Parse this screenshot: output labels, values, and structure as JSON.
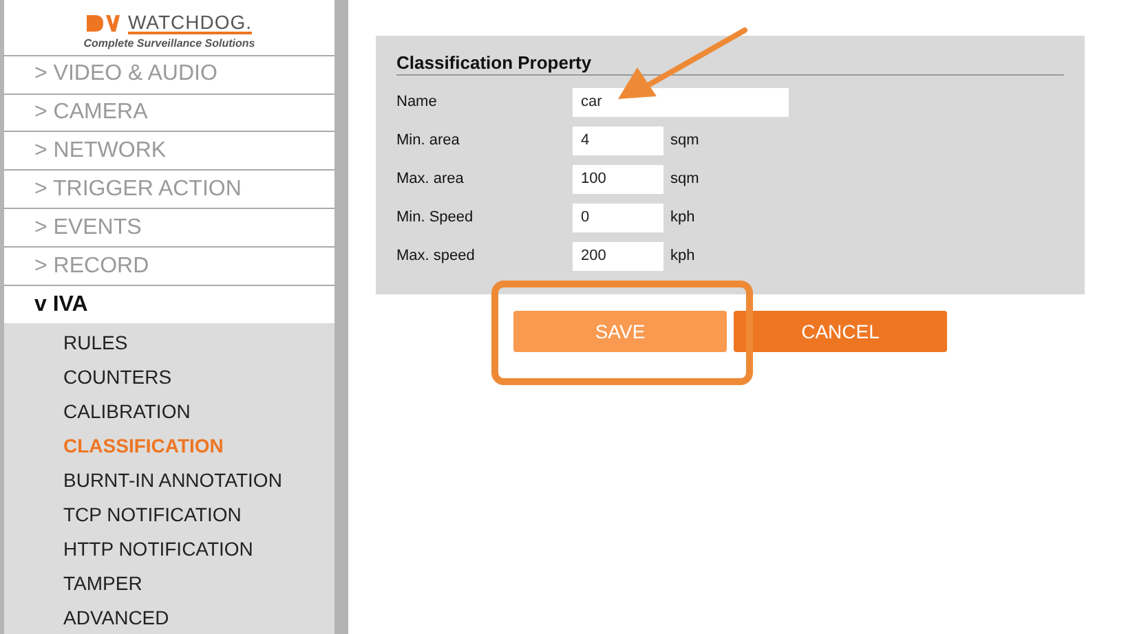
{
  "logo": {
    "wordmark": "WATCHDOG.",
    "tagline": "Complete Surveillance Solutions"
  },
  "sidebar": {
    "items": [
      {
        "label": "> VIDEO & AUDIO",
        "expanded": false
      },
      {
        "label": "> CAMERA",
        "expanded": false
      },
      {
        "label": "> NETWORK",
        "expanded": false
      },
      {
        "label": "> TRIGGER ACTION",
        "expanded": false
      },
      {
        "label": "> EVENTS",
        "expanded": false
      },
      {
        "label": "> RECORD",
        "expanded": false
      },
      {
        "label": "v IVA",
        "expanded": true,
        "children": [
          {
            "label": "RULES",
            "selected": false
          },
          {
            "label": "COUNTERS",
            "selected": false
          },
          {
            "label": "CALIBRATION",
            "selected": false
          },
          {
            "label": "CLASSIFICATION",
            "selected": true
          },
          {
            "label": "BURNT-IN ANNOTATION",
            "selected": false
          },
          {
            "label": "TCP NOTIFICATION",
            "selected": false
          },
          {
            "label": "HTTP NOTIFICATION",
            "selected": false
          },
          {
            "label": "TAMPER",
            "selected": false
          },
          {
            "label": "ADVANCED",
            "selected": false
          }
        ]
      }
    ]
  },
  "panel": {
    "title": "Classification Property",
    "fields": [
      {
        "label": "Name",
        "value": "car",
        "kind": "wide"
      },
      {
        "label": "Min. area",
        "value": "4",
        "unit": "sqm",
        "kind": "short"
      },
      {
        "label": "Max. area",
        "value": "100",
        "unit": "sqm",
        "kind": "short"
      },
      {
        "label": "Min. Speed",
        "value": "0",
        "unit": "kph",
        "kind": "short"
      },
      {
        "label": "Max. speed",
        "value": "200",
        "unit": "kph",
        "kind": "short"
      }
    ]
  },
  "buttons": [
    {
      "label": "SAVE",
      "kind": "save"
    },
    {
      "label": "CANCEL",
      "kind": "cancel"
    }
  ]
}
